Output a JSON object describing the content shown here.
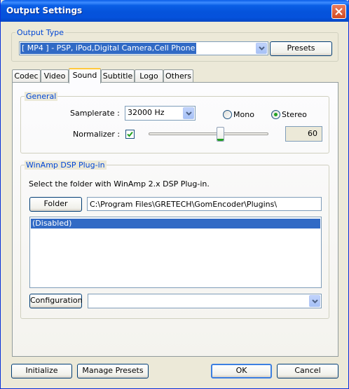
{
  "window": {
    "title": "Output Settings"
  },
  "output_type": {
    "legend": "Output Type",
    "selected": "[ MP4 ] - PSP, iPod,Digital Camera,Cell Phone",
    "presets_label": "Presets"
  },
  "tabs": [
    {
      "label": "Codec",
      "active": false
    },
    {
      "label": "Video",
      "active": false
    },
    {
      "label": "Sound",
      "active": true
    },
    {
      "label": "Subtitle",
      "active": false
    },
    {
      "label": "Logo",
      "active": false
    },
    {
      "label": "Others",
      "active": false
    }
  ],
  "general": {
    "legend": "General",
    "samplerate_label": "Samplerate :",
    "samplerate_value": "32000 Hz",
    "mono_label": "Mono",
    "stereo_label": "Stereo",
    "channel_selected": "Stereo",
    "normalizer_label": "Normalizer :",
    "normalizer_checked": true,
    "normalizer_level": 60,
    "normalizer_value": "60"
  },
  "winamp": {
    "legend": "WinAmp DSP Plug-in",
    "instruction": "Select the folder with WinAmp 2.x DSP Plug-in.",
    "folder_button": "Folder",
    "folder_path": "C:\\Program Files\\GRETECH\\GomEncoder\\Plugins\\",
    "plugins": [
      "(Disabled)"
    ],
    "selected_plugin_index": 0,
    "configuration_button": "Configuration",
    "configuration_value": ""
  },
  "footer": {
    "initialize_label": "Initialize",
    "manage_presets_label": "Manage Presets",
    "ok_label": "OK",
    "cancel_label": "Cancel"
  },
  "colors": {
    "titlebar": "#0553db",
    "accent_text": "#0046d5",
    "selection": "#316ac5",
    "radio_dot": "#21a121"
  }
}
